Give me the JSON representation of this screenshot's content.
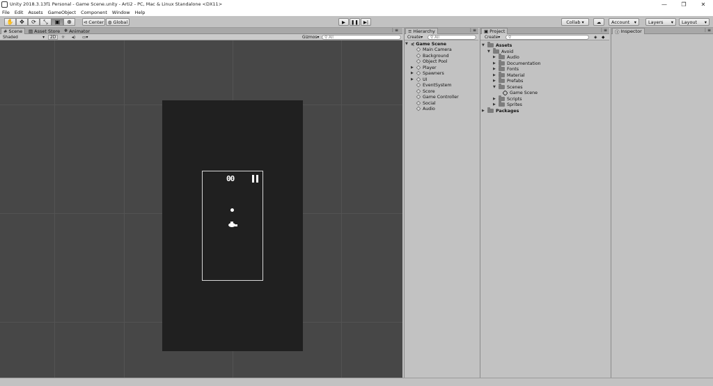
{
  "window": {
    "title": "Unity 2018.3.13f1 Personal - Game Scene.unity - Arti2 - PC, Mac & Linux Standalone <DX11>",
    "minimize": "—",
    "maximize": "❐",
    "close": "✕"
  },
  "menu": [
    "File",
    "Edit",
    "Assets",
    "GameObject",
    "Component",
    "Window",
    "Help"
  ],
  "toolbar": {
    "pivot_label": "Center",
    "space_label": "Global",
    "collab_label": "Collab ▾",
    "account_label": "Account",
    "layers_label": "Layers",
    "layout_label": "Layout"
  },
  "scene_panel": {
    "tabs": [
      "Scene",
      "Asset Store",
      "Animator"
    ],
    "shading_mode": "Shaded",
    "mode_2d": "2D",
    "gizmos_label": "Gizmos",
    "search_placeholder": "All"
  },
  "game_preview": {
    "score": "00"
  },
  "hierarchy": {
    "tab_label": "Hierarchy",
    "create_label": "Create",
    "search_placeholder": "All",
    "scene_name": "Game Scene",
    "items": [
      "Main Camera",
      "Background",
      "Object Pool",
      "Player",
      "Spawners",
      "UI",
      "EventSystem",
      "Score",
      "Game Controller",
      "Social",
      "Audio"
    ]
  },
  "project": {
    "tab_label": "Project",
    "create_label": "Create",
    "root_assets": "Assets",
    "avoid_folder": "Avoid",
    "folders": [
      "Audio",
      "Documentation",
      "Fonts",
      "Material",
      "Prefabs",
      "Scenes"
    ],
    "scene_asset": "Game Scene",
    "more_folders": [
      "Scripts",
      "Sprites"
    ],
    "root_packages": "Packages"
  },
  "inspector": {
    "tab_label": "Inspector"
  }
}
